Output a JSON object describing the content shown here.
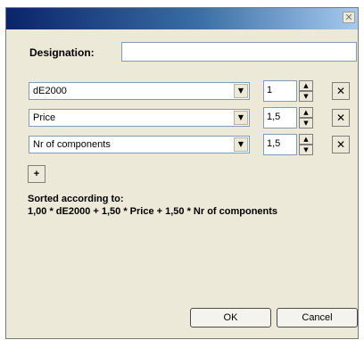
{
  "titlebar": {
    "close_label": "✕"
  },
  "designation": {
    "label": "Designation:",
    "value": ""
  },
  "criteria": [
    {
      "criterion": "dE2000",
      "weight": "1",
      "remove_label": "✕"
    },
    {
      "criterion": "Price",
      "weight": "1,5",
      "remove_label": "✕"
    },
    {
      "criterion": "Nr of components",
      "weight": "1,5",
      "remove_label": "✕"
    }
  ],
  "icons": {
    "dropdown": "▼",
    "spin_up": "▲",
    "spin_down": "▼"
  },
  "add_label": "+",
  "sorted": {
    "heading": "Sorted according to:",
    "formula": "1,00 * dE2000 + 1,50 * Price + 1,50 * Nr of components"
  },
  "buttons": {
    "ok": "OK",
    "cancel": "Cancel"
  }
}
